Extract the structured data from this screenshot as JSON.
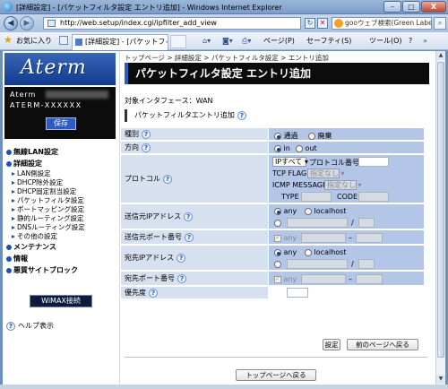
{
  "window": {
    "title": "[詳細設定] - [パケットフィルタ設定 エントリ追加] - Windows Internet Explorer",
    "min": "–",
    "max": "□",
    "close": "X"
  },
  "address": {
    "url": "http://web.setup/index.cgi/ipfilter_add_view",
    "search": "gooウェブ検索(Green Label)"
  },
  "commandbar": {
    "favorites": "お気に入り",
    "tab_label": "[詳細設定] - [パケットフィルタ...",
    "page": "ページ(P)",
    "safety": "セーフティ(S)",
    "tools": "ツール(O)",
    "help": "?"
  },
  "left": {
    "logo": "Aterm",
    "model_line1": "Aterm",
    "model_line2": "ATERM-XXXXXX",
    "save": "保存",
    "menu": [
      {
        "label": "無線LAN設定",
        "level": 1
      },
      {
        "label": "詳細設定",
        "level": 1
      },
      {
        "label": "LAN側設定",
        "level": 2
      },
      {
        "label": "DHCP除外設定",
        "level": 2
      },
      {
        "label": "DHCP固定割当設定",
        "level": 2
      },
      {
        "label": "パケットフィルタ設定",
        "level": 2
      },
      {
        "label": "ポートマッピング設定",
        "level": 2
      },
      {
        "label": "静的ルーティング設定",
        "level": 2
      },
      {
        "label": "DNSルーティング設定",
        "level": 2
      },
      {
        "label": "その他の設定",
        "level": 2
      },
      {
        "label": "メンテナンス",
        "level": 1
      },
      {
        "label": "情報",
        "level": 1
      },
      {
        "label": "悪質サイトブロック",
        "level": 1
      }
    ],
    "wimax": "WiMAX接続",
    "help": "ヘルプ表示"
  },
  "main": {
    "breadcrumb": "トップページ > 詳細設定 > パケットフィルタ設定 > エントリ追加",
    "title": "パケットフィルタ設定 エントリ追加",
    "interface": "対象インタフェース：WAN",
    "section": "パケットフィルタエントリ追加",
    "rows": {
      "type": {
        "label": "種別",
        "opt1": "通過",
        "opt2": "廃棄"
      },
      "direction": {
        "label": "方向",
        "opt1": "in",
        "opt2": "out"
      },
      "protocol": {
        "label": "プロトコル",
        "select": "IPすべて",
        "proto_num": "プロトコル番号",
        "tcp_flag": "TCP FLAG",
        "tcp_flag_val": "指定なし",
        "icmp": "ICMP MESSAGE",
        "icmp_val": "指定なし",
        "type": "TYPE",
        "code": "CODE"
      },
      "src_ip": {
        "label": "送信元IPアドレス",
        "any": "any",
        "localhost": "localhost",
        "slash": "/"
      },
      "src_port": {
        "label": "送信元ポート番号",
        "any": "any",
        "dash": "–"
      },
      "dst_ip": {
        "label": "宛先IPアドレス",
        "any": "any",
        "localhost": "localhost",
        "slash": "/"
      },
      "dst_port": {
        "label": "宛先ポート番号",
        "any": "any",
        "dash": "–"
      },
      "priority": {
        "label": "優先度"
      }
    },
    "btn_set": "設定",
    "btn_back": "前のページへ戻る",
    "btn_top": "トップページへ戻る"
  }
}
